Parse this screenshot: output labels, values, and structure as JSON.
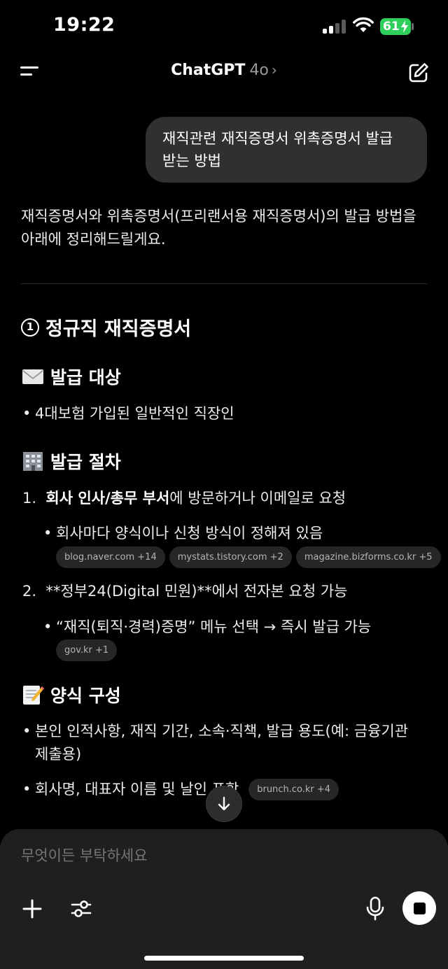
{
  "status_bar": {
    "time": "19:22",
    "battery": "61"
  },
  "header": {
    "app_name": "ChatGPT",
    "model": "4o",
    "chevron": "›"
  },
  "chat": {
    "user_message": "재직관련 재직증명서 위촉증명서 발급 받는 방법",
    "intro": "재직증명서와 위촉증명서(프리랜서용 재직증명서)의 발급 방법을 아래에 정리해드릴게요.",
    "section_number": "1",
    "section_title": "정규직 재직증명서",
    "h_target": "발급 대상",
    "target_bullet": "4대보험 가입된 일반적인 직장인",
    "h_process": "발급 절차",
    "step1_num": "1.",
    "step1_bold": "회사 인사/총무 부서",
    "step1_rest": "에 방문하거나 이메일로 요청",
    "step1_sub": "회사마다 양식이나 신청 방식이 정해져 있음",
    "step1_sources": [
      "blog.naver.com +14",
      "mystats.tistory.com +2",
      "magazine.bizforms.co.kr +5"
    ],
    "step2_num": "2.",
    "step2_text": "**정부24(Digital 민원)**에서 전자본 요청 가능",
    "step2_sub": "“재직(퇴직·경력)증명” 메뉴 선택 → 즉시 발급 가능",
    "step2_sources": [
      "gov.kr +1"
    ],
    "h_form": "양식 구성",
    "form_bullet1": "본인 인적사항, 재직 기간, 소속·직책, 발급 용도(예: 금융기관 제출용)",
    "form_bullet2": "회사명, 대표자 이름 및 날인 포함",
    "form_sources": [
      "brunch.co.kr +4"
    ]
  },
  "composer": {
    "placeholder": "무엇이든 부탁하세요"
  },
  "colors": {
    "background": "#000000",
    "bubble": "#303030",
    "composer": "#1f1f1f",
    "chip": "#262626",
    "battery": "#2fcf5b"
  },
  "icons": [
    "menu-icon",
    "edit-icon",
    "envelope-icon",
    "office-building-icon",
    "memo-icon",
    "arrow-down-icon",
    "plus-icon",
    "sliders-icon",
    "microphone-icon",
    "stop-icon"
  ]
}
